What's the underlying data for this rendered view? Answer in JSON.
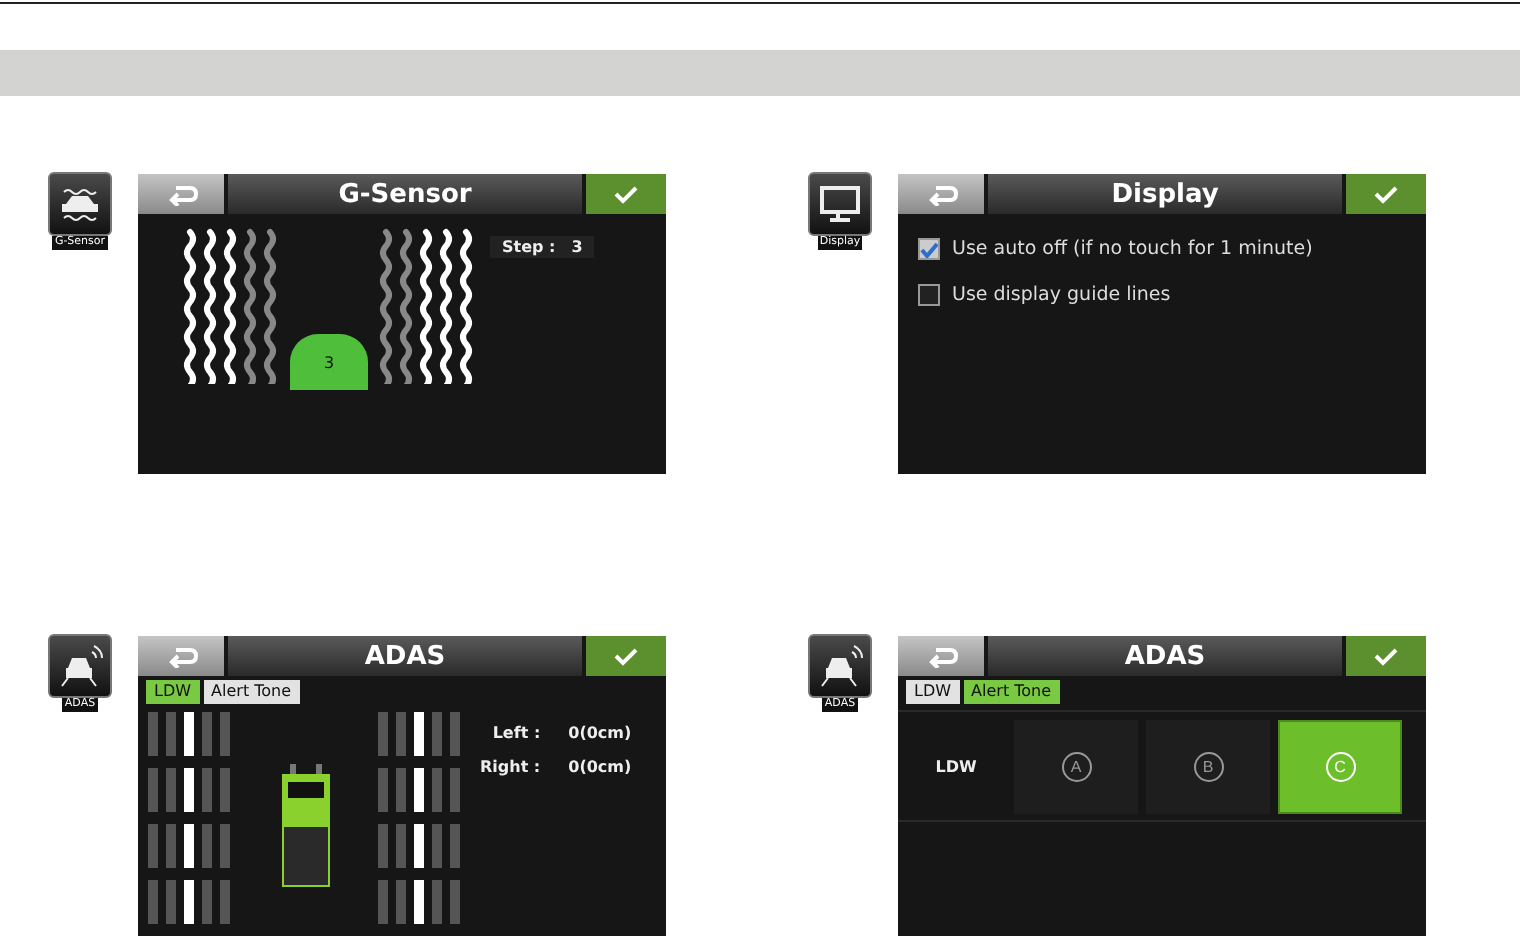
{
  "panels": [
    {
      "kind": "g-sensor",
      "icon_label": "G-Sensor",
      "title": "G-Sensor",
      "badge": "3",
      "step_label": "Step :",
      "step_value": "3"
    },
    {
      "kind": "display",
      "icon_label": "Display",
      "title": "Display",
      "options": [
        {
          "label": "Use auto off (if no touch for 1 minute)",
          "checked": true
        },
        {
          "label": "Use display guide lines",
          "checked": false
        }
      ]
    },
    {
      "kind": "adas-ldw",
      "icon_label": "ADAS",
      "title": "ADAS",
      "tabs": [
        {
          "label": "LDW",
          "selected": true
        },
        {
          "label": "Alert Tone",
          "selected": false
        }
      ],
      "readings": [
        {
          "label": "Left :",
          "value": "0(0cm)"
        },
        {
          "label": "Right :",
          "value": "0(0cm)"
        }
      ]
    },
    {
      "kind": "adas-tone",
      "icon_label": "ADAS",
      "title": "ADAS",
      "tabs": [
        {
          "label": "LDW",
          "selected": false
        },
        {
          "label": "Alert Tone",
          "selected": true
        }
      ],
      "row_label": "LDW",
      "choices": [
        {
          "label": "A",
          "selected": false
        },
        {
          "label": "B",
          "selected": false
        },
        {
          "label": "C",
          "selected": true
        }
      ]
    }
  ]
}
